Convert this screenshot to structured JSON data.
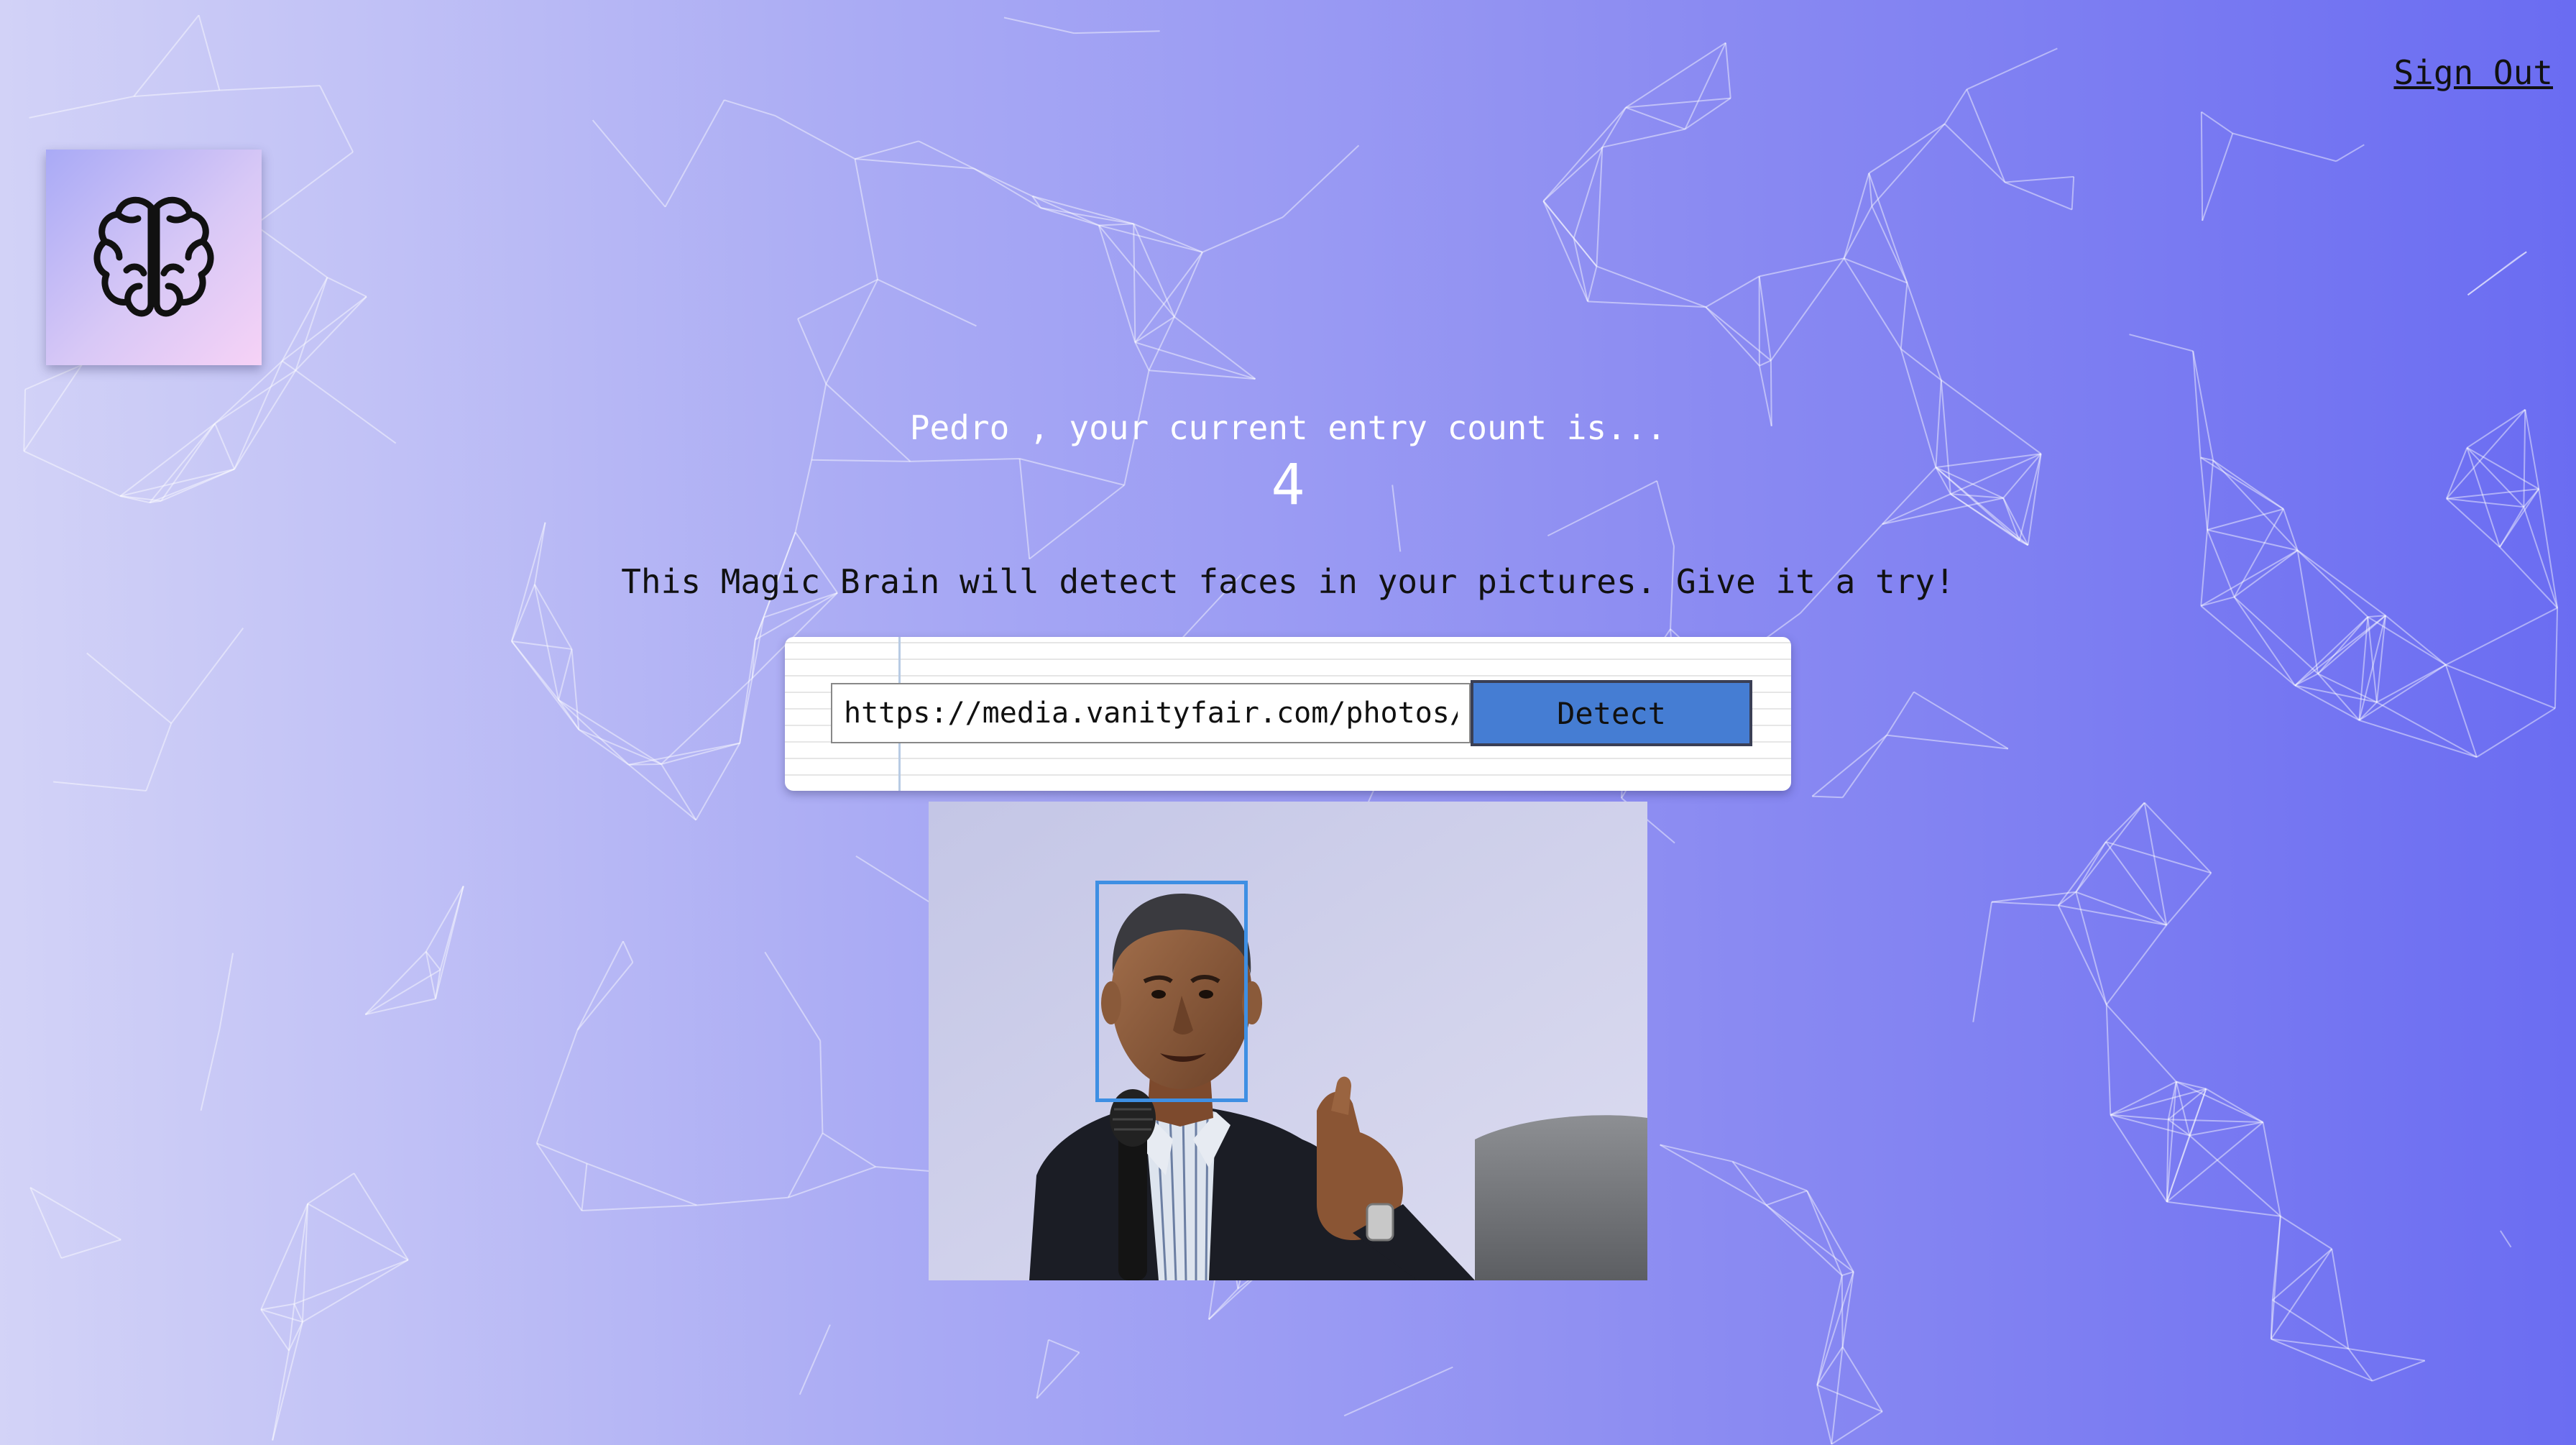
{
  "nav": {
    "sign_out_label": "Sign Out"
  },
  "logo": {
    "icon": "brain-icon"
  },
  "rank": {
    "user_name": "Pedro",
    "message_suffix": ", your current entry count is...",
    "entry_count": "4"
  },
  "tagline": "This Magic Brain will detect faces in your pictures. Give it a try!",
  "image_form": {
    "url_value": "https://media.vanityfair.com/photos/",
    "detect_label": "Detect"
  },
  "face_detection": {
    "result_image": "portrait of a man in a dark suit speaking into a microphone",
    "box_color": "#3e8fe3"
  },
  "colors": {
    "gradient_start": "#d3d3f7",
    "gradient_end": "#6a6cf2",
    "button": "#457dd3"
  }
}
